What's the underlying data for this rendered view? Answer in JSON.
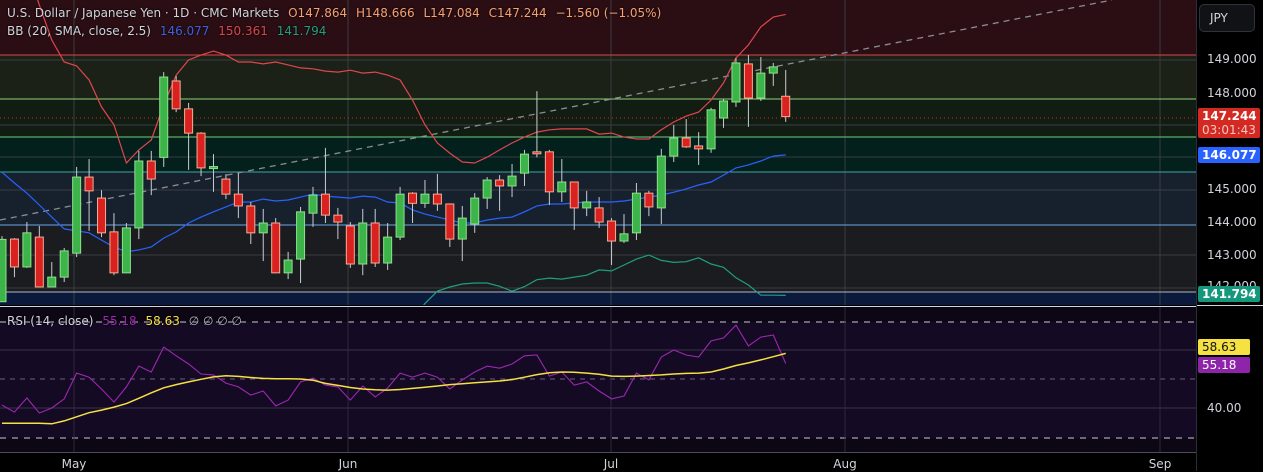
{
  "header": {
    "title": "U.S. Dollar / Japanese Yen · 1D · CMC Markets",
    "open": "O147.864",
    "high": "H148.666",
    "low": "L147.084",
    "close": "C147.244",
    "change": "−1.560 (−1.05%)"
  },
  "bb_legend": {
    "label": "BB (20, SMA, close, 2.5)",
    "basis": "146.077",
    "upper": "150.361",
    "lower": "141.794"
  },
  "rsi_legend": {
    "label": "RSI (14, close)",
    "rsi": "55.18",
    "ma": "58.63",
    "empty": "∅ ∅ ∅ ∅"
  },
  "axis": {
    "currency": "JPY",
    "price_labels": [
      "149.000",
      "148.000",
      "145.000",
      "144.000",
      "143.000",
      "142.000"
    ],
    "last_price": "147.244",
    "countdown": "03:01:43",
    "bb_basis": "146.077",
    "bb_lower": "141.794",
    "rsi_ma": "58.63",
    "rsi_value": "55.18",
    "rsi_label": "40.00"
  },
  "time_labels": [
    "May",
    "Jun",
    "Jul",
    "Aug",
    "Sep"
  ],
  "colors": {
    "up": "#3cb44a",
    "down": "#d9221f",
    "bb_basis": "#2962ff",
    "bb_upper": "#e0464f",
    "bb_lower": "#1e9e80",
    "rsi": "#9c27b0",
    "rsi_ma": "#f5e142"
  },
  "chart_data": {
    "type": "candlestick",
    "symbol": "USDJPY",
    "ohlc": [
      [
        141.6,
        143.6,
        141.6,
        143.5
      ],
      [
        143.51,
        143.54,
        142.35,
        142.66
      ],
      [
        142.66,
        144.03,
        142.63,
        143.7
      ],
      [
        143.57,
        143.91,
        142.05,
        142.05
      ],
      [
        142.05,
        142.81,
        142.05,
        142.35
      ],
      [
        142.35,
        143.24,
        142.2,
        143.15
      ],
      [
        143.08,
        145.71,
        142.96,
        145.4
      ],
      [
        145.4,
        145.95,
        143.76,
        144.98
      ],
      [
        144.76,
        145.0,
        143.57,
        143.7
      ],
      [
        143.73,
        144.3,
        142.41,
        142.48
      ],
      [
        142.48,
        144.0,
        142.48,
        143.85
      ],
      [
        143.85,
        146.2,
        143.51,
        145.89
      ],
      [
        145.89,
        146.2,
        144.85,
        145.34
      ],
      [
        146.0,
        148.6,
        145.71,
        148.45
      ],
      [
        148.33,
        148.48,
        147.38,
        147.48
      ],
      [
        147.48,
        147.66,
        145.62,
        146.74
      ],
      [
        146.74,
        146.77,
        145.43,
        145.68
      ],
      [
        145.71,
        146.1,
        144.95,
        145.72
      ],
      [
        145.34,
        145.49,
        144.73,
        144.88
      ],
      [
        144.88,
        145.52,
        144.15,
        144.52
      ],
      [
        144.52,
        144.64,
        143.36,
        143.7
      ],
      [
        143.7,
        144.43,
        142.84,
        144.0
      ],
      [
        144.0,
        144.15,
        142.48,
        142.48
      ],
      [
        142.48,
        143.12,
        142.29,
        142.87
      ],
      [
        142.9,
        144.49,
        142.17,
        144.34
      ],
      [
        144.3,
        145.1,
        143.88,
        144.85
      ],
      [
        144.88,
        146.29,
        144.0,
        144.24
      ],
      [
        144.24,
        144.46,
        143.51,
        144.03
      ],
      [
        143.91,
        144.03,
        142.63,
        142.75
      ],
      [
        142.75,
        144.43,
        142.41,
        144.0
      ],
      [
        144.0,
        144.43,
        142.66,
        142.78
      ],
      [
        142.78,
        144.0,
        142.57,
        143.57
      ],
      [
        143.57,
        145.1,
        143.48,
        144.88
      ],
      [
        144.91,
        144.94,
        144.0,
        144.6
      ],
      [
        144.6,
        145.31,
        144.46,
        144.88
      ],
      [
        144.88,
        145.5,
        144.37,
        144.58
      ],
      [
        144.58,
        144.6,
        143.27,
        143.51
      ],
      [
        143.51,
        144.52,
        142.84,
        144.15
      ],
      [
        143.97,
        144.91,
        143.7,
        144.76
      ],
      [
        144.76,
        145.4,
        144.43,
        145.31
      ],
      [
        145.31,
        145.46,
        144.37,
        145.13
      ],
      [
        145.13,
        145.8,
        144.79,
        145.43
      ],
      [
        145.52,
        146.23,
        145.13,
        146.1
      ],
      [
        146.17,
        148.02,
        146.0,
        146.13
      ],
      [
        146.17,
        146.23,
        144.55,
        144.95
      ],
      [
        144.95,
        145.95,
        144.64,
        145.25
      ],
      [
        145.25,
        145.25,
        143.79,
        144.46
      ],
      [
        144.46,
        144.98,
        144.21,
        144.64
      ],
      [
        144.46,
        144.79,
        143.85,
        144.03
      ],
      [
        144.06,
        144.15,
        142.72,
        143.45
      ],
      [
        143.45,
        144.27,
        143.39,
        143.67
      ],
      [
        143.7,
        145.22,
        143.48,
        144.91
      ],
      [
        144.91,
        144.98,
        144.21,
        144.49
      ],
      [
        144.46,
        146.26,
        143.97,
        146.04
      ],
      [
        146.04,
        146.99,
        145.86,
        146.59
      ],
      [
        146.59,
        147.17,
        146.29,
        146.32
      ],
      [
        146.35,
        146.77,
        145.77,
        146.26
      ],
      [
        146.26,
        147.51,
        146.14,
        147.45
      ],
      [
        147.2,
        147.78,
        146.9,
        147.72
      ],
      [
        147.69,
        149.03,
        147.54,
        148.88
      ],
      [
        148.85,
        149.12,
        146.93,
        147.81
      ],
      [
        147.81,
        149.06,
        147.72,
        148.57
      ],
      [
        148.57,
        148.88,
        148.18,
        148.76
      ],
      [
        147.864,
        148.666,
        147.084,
        147.244
      ]
    ],
    "bb_upper": [
      152.5,
      152.2,
      151.8,
      150.65,
      149.58,
      148.91,
      148.79,
      148.36,
      147.54,
      146.99,
      145.83,
      146.23,
      146.53,
      147.6,
      148.51,
      148.97,
      149.12,
      149.24,
      149.12,
      148.91,
      148.91,
      148.85,
      148.91,
      148.82,
      148.73,
      148.7,
      148.63,
      148.6,
      148.66,
      148.57,
      148.6,
      148.51,
      148.36,
      147.75,
      146.99,
      146.44,
      146.13,
      145.86,
      145.83,
      146.01,
      146.23,
      146.44,
      146.62,
      146.77,
      146.84,
      146.87,
      146.87,
      146.87,
      146.71,
      146.74,
      146.62,
      146.56,
      146.56,
      146.84,
      147.08,
      147.26,
      147.38,
      147.75,
      148.27,
      149.03,
      149.43,
      149.98,
      150.28,
      150.361
    ],
    "bb_basis": [
      145.55,
      145.22,
      144.91,
      144.55,
      144.18,
      143.82,
      143.76,
      143.7,
      143.48,
      143.27,
      143.12,
      143.18,
      143.27,
      143.54,
      143.73,
      144.0,
      144.18,
      144.34,
      144.49,
      144.64,
      144.64,
      144.73,
      144.67,
      144.7,
      144.79,
      144.88,
      144.82,
      144.79,
      144.76,
      144.82,
      144.79,
      144.64,
      144.61,
      144.4,
      144.27,
      144.18,
      144.09,
      144.0,
      144.0,
      144.09,
      144.15,
      144.18,
      144.34,
      144.52,
      144.58,
      144.58,
      144.61,
      144.64,
      144.64,
      144.64,
      144.67,
      144.73,
      144.79,
      144.85,
      144.94,
      145.04,
      145.16,
      145.25,
      145.46,
      145.68,
      145.77,
      145.89,
      146.04,
      146.077
    ],
    "rsi": [
      41.0,
      38.6,
      43.4,
      38.3,
      40.0,
      43.1,
      51.9,
      50.5,
      46.5,
      42.0,
      47.2,
      54.3,
      52.3,
      60.8,
      57.8,
      55.0,
      51.6,
      51.3,
      48.5,
      47.2,
      44.4,
      45.8,
      40.7,
      42.7,
      48.9,
      50.2,
      47.8,
      47.2,
      42.7,
      47.5,
      43.8,
      46.8,
      51.9,
      50.5,
      51.9,
      50.5,
      46.5,
      49.6,
      52.3,
      54.3,
      53.6,
      55.0,
      57.8,
      58.1,
      50.9,
      52.3,
      47.8,
      48.9,
      45.8,
      43.1,
      44.1,
      51.9,
      49.6,
      57.4,
      59.8,
      58.1,
      57.4,
      62.9,
      63.9,
      68.3,
      61.2,
      64.2,
      64.9,
      55.18
    ],
    "rsi_ma": [
      34.8,
      34.8,
      34.8,
      34.8,
      34.6,
      35.6,
      37.0,
      38.4,
      39.3,
      40.3,
      41.5,
      43.3,
      45.2,
      46.9,
      48.0,
      48.9,
      49.8,
      50.6,
      51.0,
      50.8,
      50.4,
      50.1,
      50.0,
      50.0,
      49.9,
      49.5,
      48.4,
      47.7,
      47.0,
      46.5,
      46.2,
      46.1,
      46.3,
      46.7,
      47.1,
      47.5,
      48.0,
      48.3,
      48.6,
      48.9,
      49.2,
      49.7,
      50.5,
      51.4,
      52.0,
      52.3,
      52.2,
      51.9,
      51.5,
      50.9,
      50.8,
      50.9,
      51.1,
      51.3,
      51.6,
      51.8,
      51.9,
      52.3,
      53.3,
      54.5,
      55.4,
      56.4,
      57.5,
      58.63
    ],
    "rsi_levels": [
      70,
      60,
      50,
      40,
      30
    ],
    "price_range": [
      141.5,
      150.8
    ]
  }
}
